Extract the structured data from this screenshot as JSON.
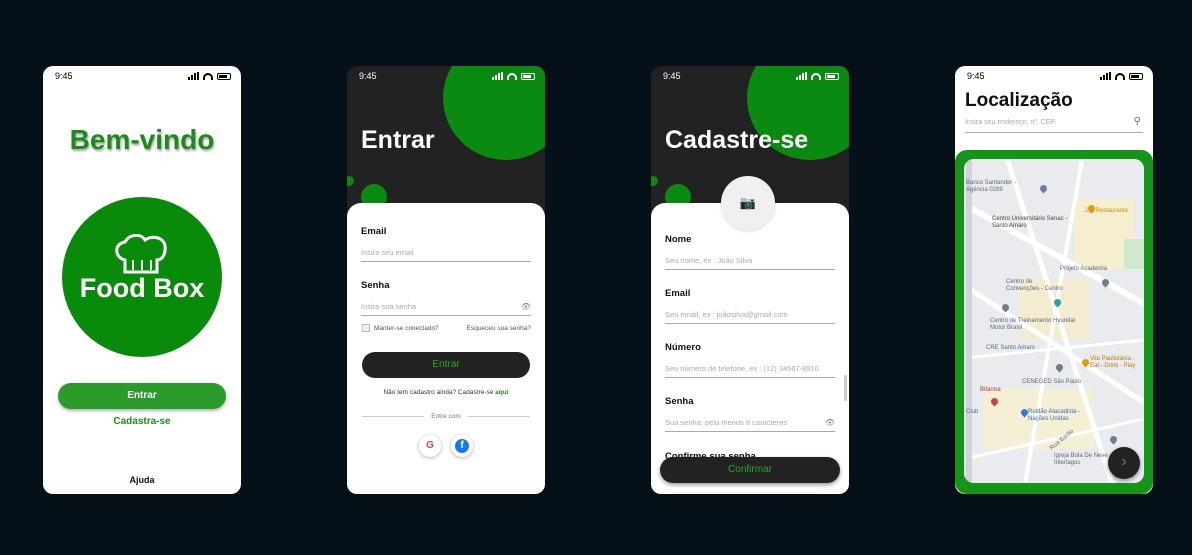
{
  "colors": {
    "background": "#061018",
    "brand_green": "#0a8a0a",
    "dark": "#222222"
  },
  "status": {
    "time": "9:45"
  },
  "welcome_screen": {
    "title": "Bem-vindo",
    "logo_text": "Food Box",
    "login_button": "Entrar",
    "register_link": "Cadastra-se",
    "help": "Ajuda"
  },
  "login_screen": {
    "title": "Entrar",
    "email_label": "Email",
    "email_placeholder": "Insira seu email",
    "password_label": "Senha",
    "password_placeholder": "Insira sua senha",
    "remember": "Manter-se conectado?",
    "forgot": "Esqueceu sua senha?",
    "submit": "Entrar",
    "no_account": "Não tem cadastro ainda? Cadastre-se",
    "no_account_link": "aqui",
    "divider": "Entre com",
    "google": "G",
    "facebook": "f"
  },
  "register_screen": {
    "title": "Cadastre-se",
    "name_label": "Nome",
    "name_placeholder": "Seu nome, ex : João Silva",
    "email_label": "Email",
    "email_placeholder": "Seu email, ex : joãosilva@gmail.com",
    "phone_label": "Número",
    "phone_placeholder": "Seu número de telefone, ex : (12) 34567-8910",
    "password_label": "Senha",
    "password_placeholder": "Sua senha, pelo menos 8 caracteres",
    "confirm_label": "Confirme sua senha",
    "submit": "Confirmar"
  },
  "location_screen": {
    "title": "Localização",
    "search_placeholder": "Insira seu endereço, nº, CEP.",
    "map_labels": [
      "Banco Santander - Agência 0289",
      "Centro Universitário Senac - Santo Amaro",
      "JJA Restaurante",
      "Projeto Academia",
      "Centro de Convenções - Centro",
      "Centro de Treinamento Hyundai Motor Brasil",
      "CRE Santo Amaro",
      "Vila Paulistânia - Eat - Drink - Play",
      "CENEGED São Paulo",
      "Bifarma",
      "Roldão Atacadista - Nações Unidas",
      "Igreja Bola De Neve - Interlagos",
      "Club",
      "Rua Barão"
    ]
  }
}
